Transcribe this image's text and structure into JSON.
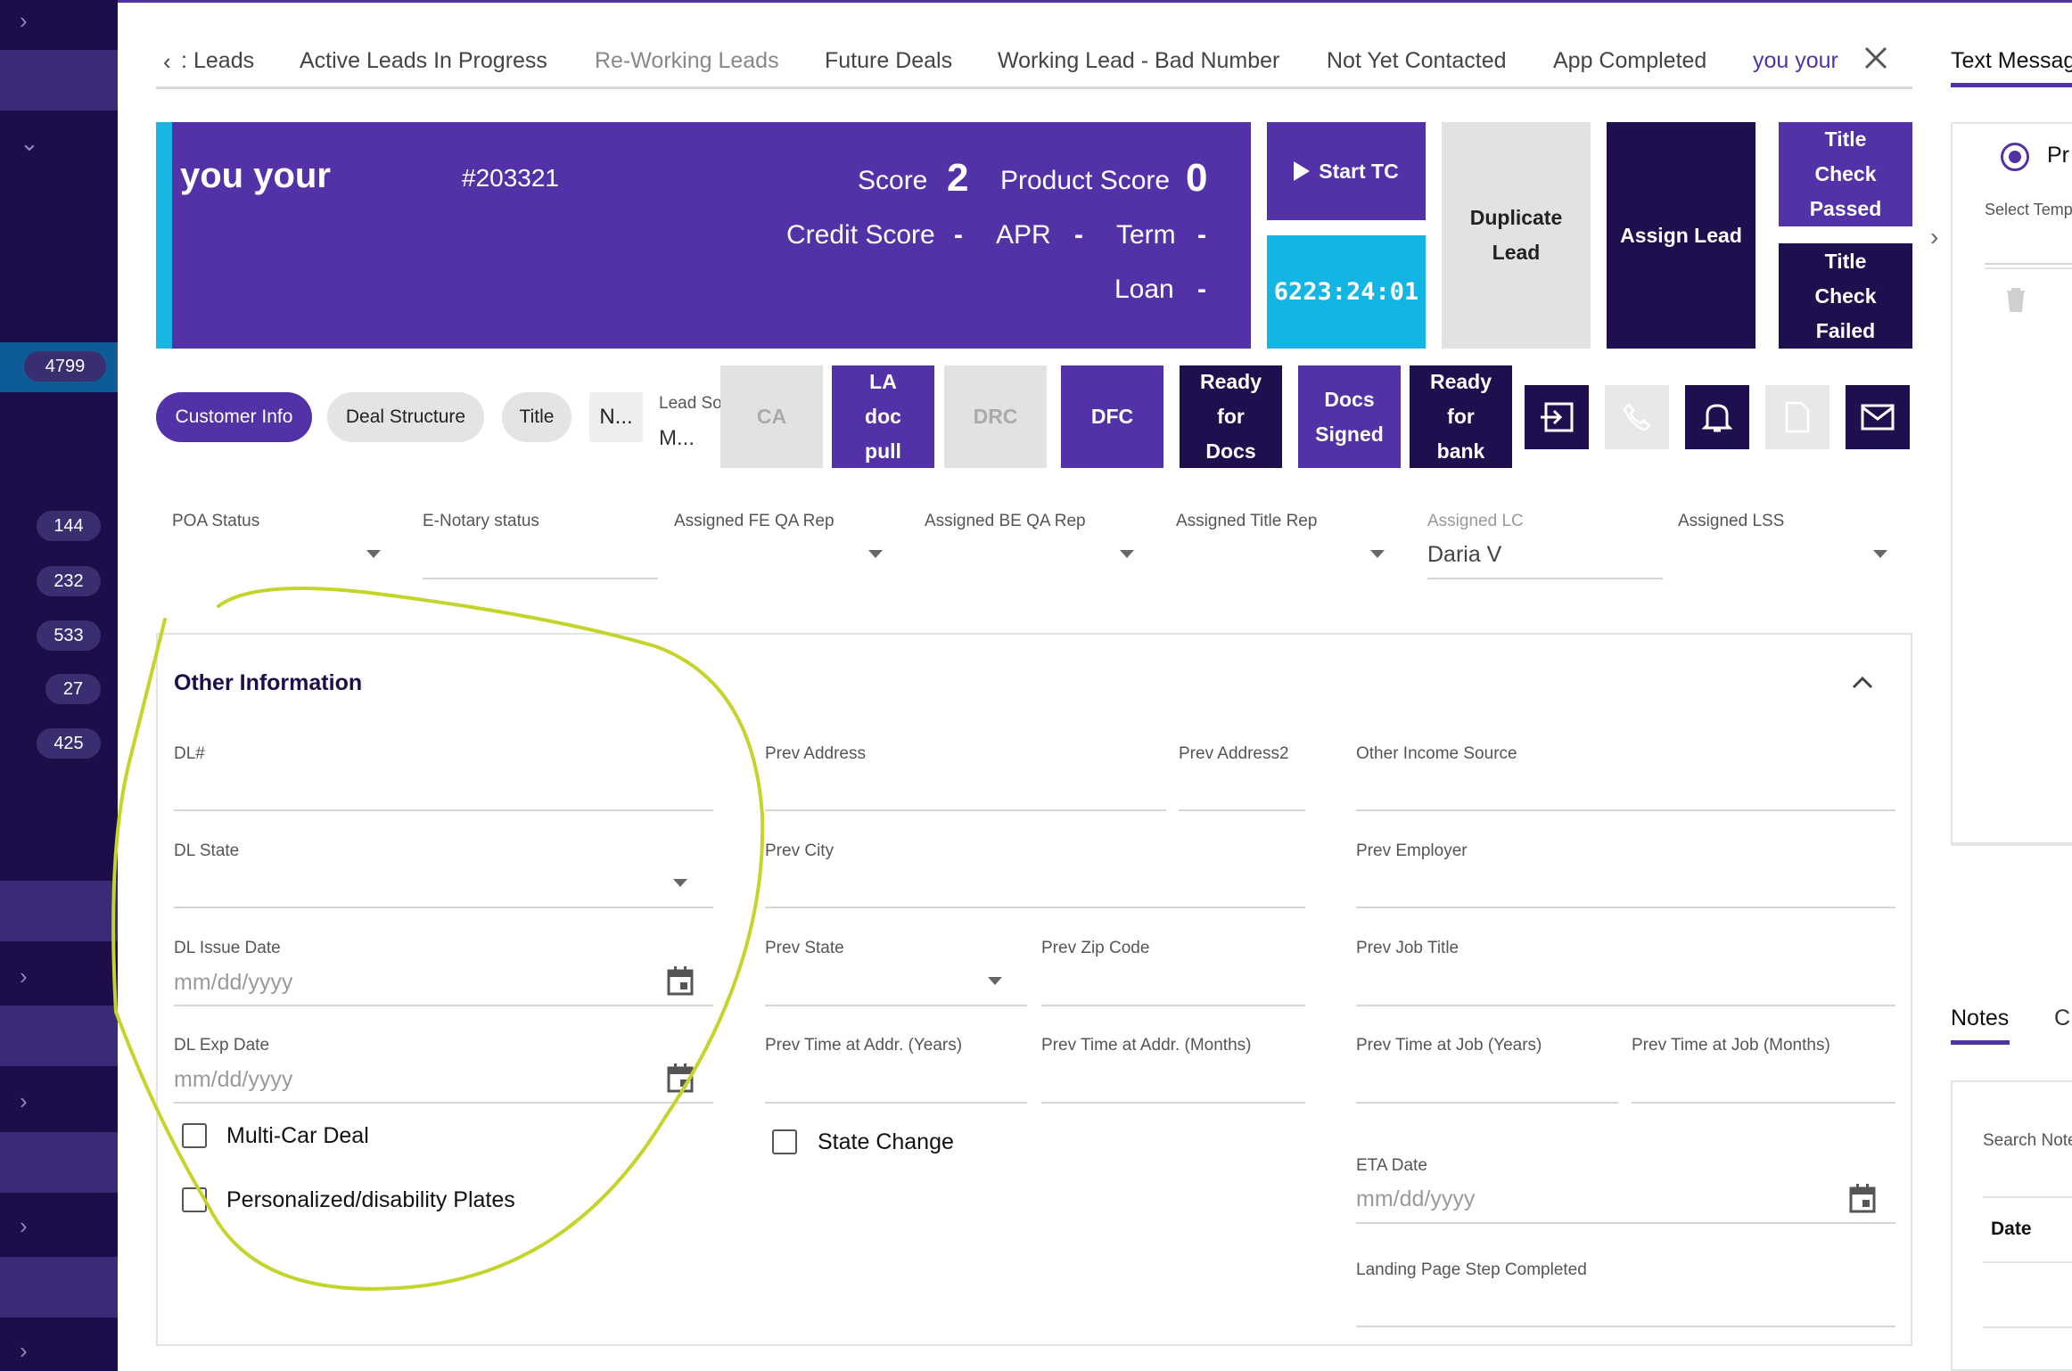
{
  "sidebar": {
    "badges": [
      "4799",
      "144",
      "232",
      "533",
      "27",
      "425"
    ]
  },
  "tabs": {
    "items": [
      "Leads",
      "Active Leads In Progress",
      "Re-Working Leads",
      "Future Deals",
      "Working Lead - Bad Number",
      "Not Yet Contacted",
      "App Completed",
      "you your"
    ],
    "back_prefix": ":",
    "text_messages": "Text Messag"
  },
  "header": {
    "name": "you your",
    "lead_id": "#203321",
    "score_label": "Score",
    "score_value": "2",
    "product_score_label": "Product Score",
    "product_score_value": "0",
    "credit_score_label": "Credit Score",
    "credit_score_value": "-",
    "apr_label": "APR",
    "apr_value": "-",
    "term_label": "Term",
    "term_value": "-",
    "loan_label": "Loan",
    "loan_value": "-"
  },
  "actions": {
    "start_tc": "Start TC",
    "timer": "6223:24:01",
    "duplicate_lead_1": "Duplicate",
    "duplicate_lead_2": "Lead",
    "assign_lead": "Assign Lead",
    "title_check_passed": [
      "Title",
      "Check",
      "Passed"
    ],
    "title_check_failed": [
      "Title",
      "Check",
      "Failed"
    ]
  },
  "pills": {
    "customer_info": "Customer Info",
    "deal_structure": "Deal Structure",
    "title": "Title",
    "truncated": "N..."
  },
  "lead_source": {
    "label": "Lead Source",
    "value": "M..."
  },
  "status_buttons": {
    "ca": "CA",
    "la_doc_pull": [
      "LA",
      "doc",
      "pull"
    ],
    "drc": "DRC",
    "dfc": "DFC",
    "ready_for_docs": [
      "Ready",
      "for",
      "Docs"
    ],
    "docs_signed": [
      "Docs",
      "Signed"
    ],
    "ready_for_bank": [
      "Ready",
      "for",
      "bank"
    ]
  },
  "assign_fields": {
    "poa_status": "POA Status",
    "e_notary": "E-Notary status",
    "fe_qa": "Assigned FE QA Rep",
    "be_qa": "Assigned BE QA Rep",
    "title_rep": "Assigned Title Rep",
    "lc": "Assigned LC",
    "lc_value": "Daria V",
    "lss": "Assigned LSS"
  },
  "other_info": {
    "title": "Other Information",
    "dl_num": "DL#",
    "dl_state": "DL State",
    "dl_issue": "DL Issue Date",
    "dl_exp": "DL Exp Date",
    "date_placeholder": "mm/dd/yyyy",
    "multi_car": "Multi-Car Deal",
    "plates": "Personalized/disability Plates",
    "prev_address": "Prev Address",
    "prev_address2": "Prev Address2",
    "prev_city": "Prev City",
    "prev_state": "Prev State",
    "prev_zip": "Prev Zip Code",
    "prev_time_years": "Prev Time at Addr. (Years)",
    "prev_time_months": "Prev Time at Addr. (Months)",
    "state_change": "State Change",
    "other_income": "Other Income Source",
    "prev_employer": "Prev Employer",
    "prev_job_title": "Prev Job Title",
    "prev_job_years": "Prev Time at Job (Years)",
    "prev_job_months": "Prev Time at Job (Months)",
    "eta_date": "ETA Date",
    "landing_step": "Landing Page Step Completed"
  },
  "right_panel": {
    "radio_label": "Pr",
    "select_template": "Select Temp",
    "notes": "Notes",
    "c_tab": "C",
    "search_notes": "Search Note",
    "date_col": "Date"
  },
  "colors": {
    "sidebar": "#1d0e4a",
    "primary": "#5232a6",
    "navy": "#1f0f4e",
    "cyan": "#18b5e0",
    "annotation": "#c5d42a"
  }
}
